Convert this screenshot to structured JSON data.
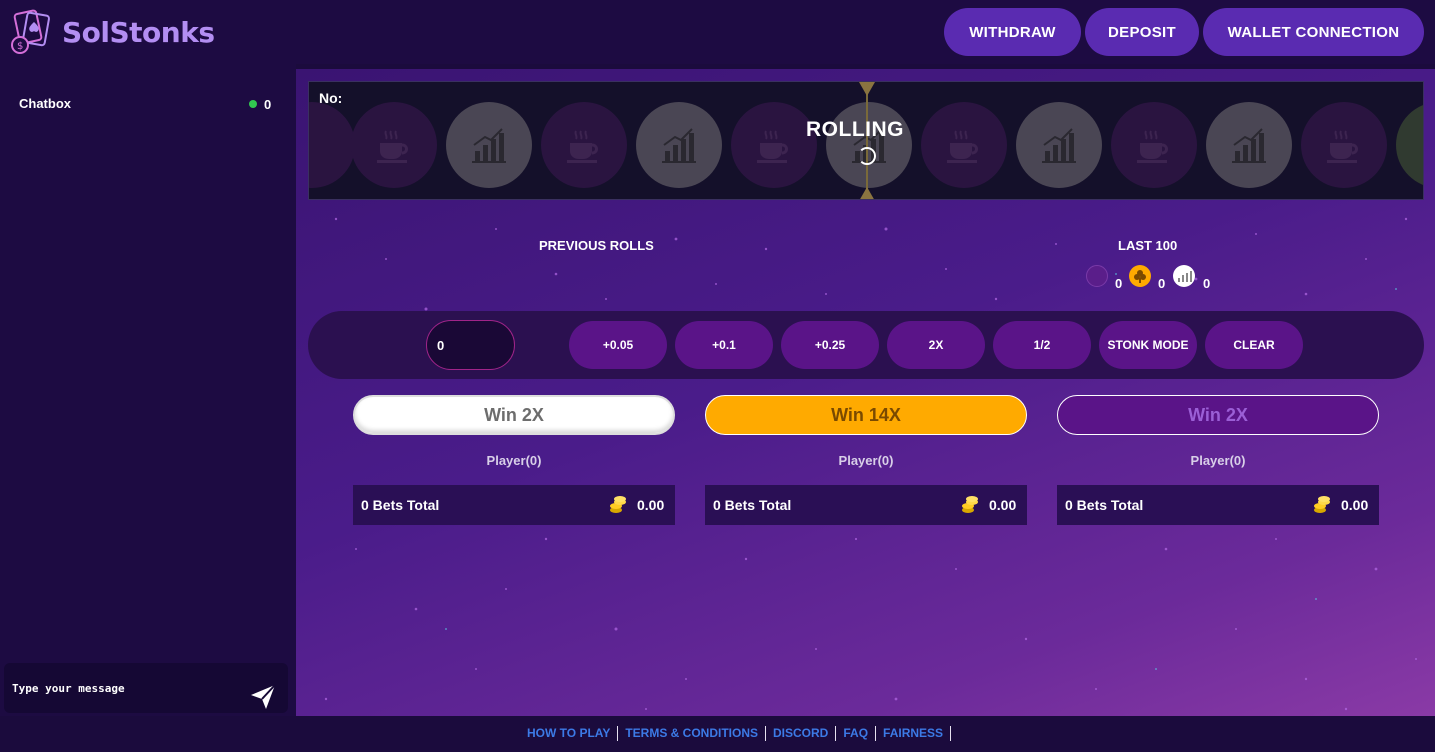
{
  "brand": {
    "name": "SolStonks"
  },
  "header": {
    "withdraw_label": "WITHDRAW",
    "deposit_label": "DEPOSIT",
    "wallet_label": "WALLET CONNECTION"
  },
  "sidebar": {
    "chat_title": "Chatbox",
    "online_count": "0",
    "input_placeholder": "Type your message"
  },
  "roller": {
    "no_label": "No:",
    "status": "ROLLING"
  },
  "history": {
    "previous_label": "PREVIOUS ROLLS",
    "last100_label": "LAST 100",
    "counts": [
      "0",
      "0",
      "0"
    ]
  },
  "bet": {
    "amount_value": "0",
    "buttons": [
      "+0.05",
      "+0.1",
      "+0.25",
      "2X",
      "1/2",
      "STONK MODE",
      "CLEAR"
    ]
  },
  "columns": [
    {
      "win_label": "Win 2X",
      "players": "Player(0)",
      "bets_total": "0 Bets Total",
      "amount": "0.00"
    },
    {
      "win_label": "Win 14X",
      "players": "Player(0)",
      "bets_total": "0 Bets Total",
      "amount": "0.00"
    },
    {
      "win_label": "Win 2X",
      "players": "Player(0)",
      "bets_total": "0 Bets Total",
      "amount": "0.00"
    }
  ],
  "footer": {
    "links": [
      "HOW TO PLAY",
      "TERMS & CONDITIONS",
      "DISCORD",
      "FAQ",
      "FAIRNESS"
    ]
  },
  "colors": {
    "primary_button": "#5a2bb1",
    "gold": "#ffaa00",
    "online_dot": "#32c850",
    "link": "#3c7ae6"
  }
}
